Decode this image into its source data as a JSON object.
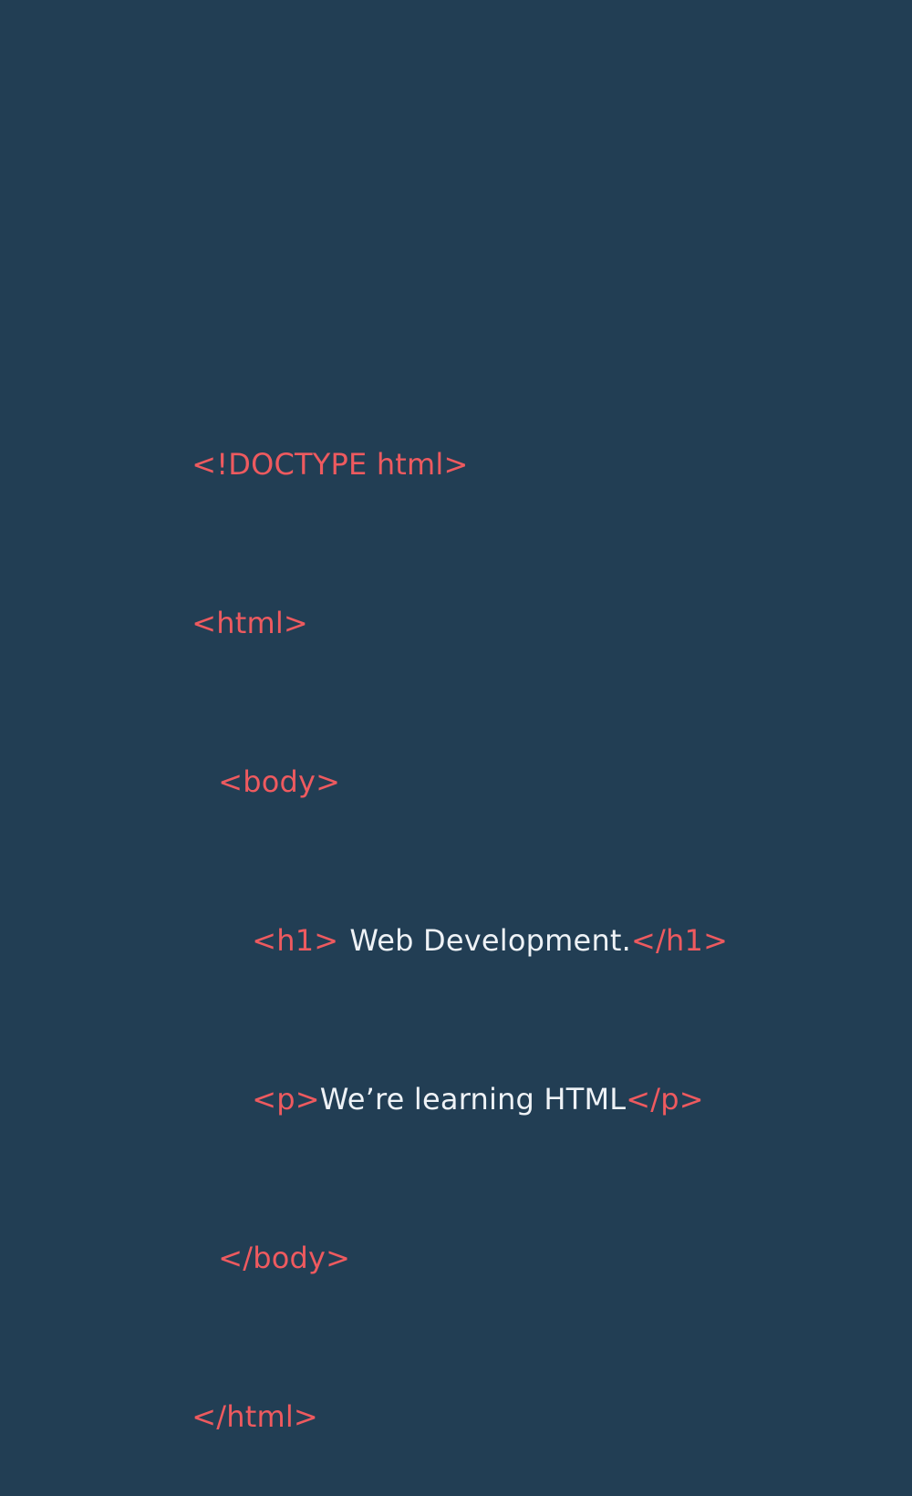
{
  "code": {
    "doctype": "<!DOCTYPE html>",
    "html_open": "<html>",
    "body_open": "<body>",
    "h1_open": "<h1>",
    "h1_text": "Web Development.",
    "h1_close": "</h1>",
    "p_open": "<p>",
    "p_text": "We’re learning HTML",
    "p_close": "</p>",
    "body_close": "</body>",
    "html_close": "</html>"
  },
  "colors": {
    "background": "#223e54",
    "tag": "#ee5a5f",
    "text": "#eef2f6"
  }
}
